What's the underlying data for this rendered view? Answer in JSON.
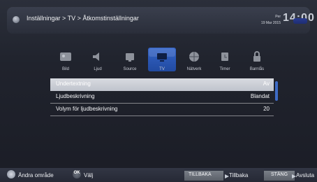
{
  "header": {
    "breadcrumb": "Inställningar > TV > Åtkomstinställningar",
    "date_top": "Per",
    "date_bottom": "19 Mar 2015",
    "time": "14:00"
  },
  "categories": [
    {
      "label": "Bild",
      "icon": "picture-icon"
    },
    {
      "label": "Ljud",
      "icon": "sound-icon"
    },
    {
      "label": "Source",
      "icon": "source-icon"
    },
    {
      "label": "TV",
      "icon": "tv-icon",
      "selected": true
    },
    {
      "label": "Nätverk",
      "icon": "network-icon"
    },
    {
      "label": "Timer",
      "icon": "timer-icon"
    },
    {
      "label": "Barnlås",
      "icon": "parental-lock-icon"
    }
  ],
  "settings": [
    {
      "label": "Undertextning",
      "value": "Av",
      "selected": true
    },
    {
      "label": "Ljudbeskrivning",
      "value": "Blandat"
    },
    {
      "label": "Volym för ljudbeskrivning",
      "value": "20"
    }
  ],
  "footer": {
    "change_area": "Ändra område",
    "select": "Välj",
    "back_button": "TILLBAKA",
    "back_text": "Tillbaka",
    "close_button": "STÄNG",
    "close_text": "Avsluta",
    "ok_glyph": "OK"
  },
  "colors": {
    "accent": "#2f5fc2",
    "background": "#20232d"
  }
}
